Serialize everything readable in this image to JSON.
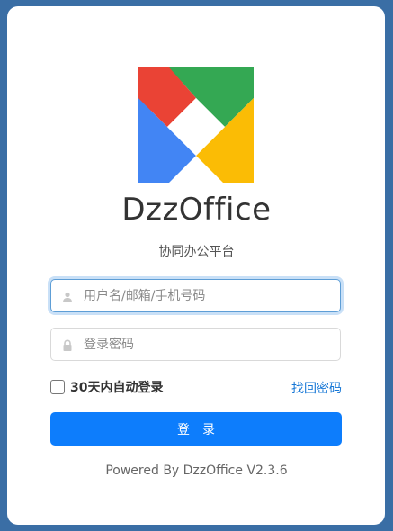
{
  "brand": {
    "app_name": "DzzOffice",
    "tagline": "协同办公平台",
    "logo_colors": {
      "red": "#ea4335",
      "green": "#34a853",
      "yellow": "#fbbc05",
      "blue": "#4285f4",
      "center": "#ffffff"
    }
  },
  "form": {
    "username": {
      "placeholder": "用户名/邮箱/手机号码",
      "value": "",
      "icon": "user-icon"
    },
    "password": {
      "placeholder": "登录密码",
      "value": "",
      "icon": "lock-icon"
    },
    "remember_label": "30天内自动登录",
    "remember_checked": false,
    "forgot_label": "找回密码",
    "submit_label": "登录"
  },
  "footer": {
    "text": "Powered By DzzOffice V2.3.6"
  },
  "colors": {
    "background": "#3a6ea5",
    "accent": "#0d7dfc",
    "link": "#1677d6"
  }
}
